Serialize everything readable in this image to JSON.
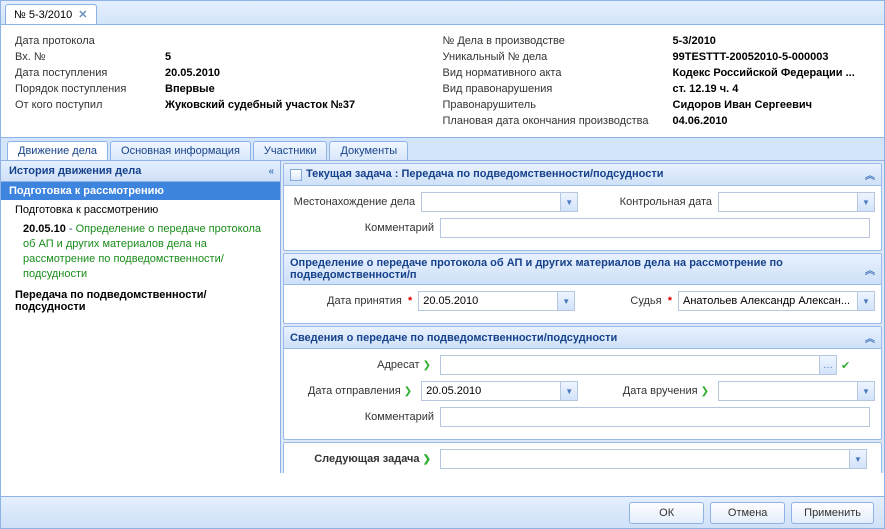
{
  "topTab": {
    "label": "№ 5-3/2010",
    "closeGlyph": "✕"
  },
  "header": {
    "left": [
      {
        "label": "Дата протокола",
        "value": ""
      },
      {
        "label": "Вх. №",
        "value": "5"
      },
      {
        "label": "Дата поступления",
        "value": "20.05.2010"
      },
      {
        "label": "Порядок поступления",
        "value": "Впервые"
      },
      {
        "label": "От кого поступил",
        "value": "Жуковский судебный участок №37"
      }
    ],
    "right": [
      {
        "label": "№ Дела в производстве",
        "value": "5-3/2010"
      },
      {
        "label": "Уникальный № дела",
        "value": "99TESTTT-20052010-5-000003"
      },
      {
        "label": "Вид нормативного акта",
        "value": "Кодекс Российской Федерации ..."
      },
      {
        "label": "Вид правонарушения",
        "value": "ст. 12.19 ч. 4"
      },
      {
        "label": "Правонарушитель",
        "value": "Сидоров Иван Сергеевич"
      },
      {
        "label": "Плановая дата окончания производства",
        "value": "04.06.2010"
      }
    ]
  },
  "tabs": [
    "Движение дела",
    "Основная информация",
    "Участники",
    "Документы"
  ],
  "activeTab": 0,
  "leftPanel": {
    "title": "История движения дела",
    "selectedStage": "Подготовка к рассмотрению",
    "stage1": "Подготовка к рассмотрению",
    "entryDate": "20.05.10",
    "entrySep": " - ",
    "entryText": "Определение о передаче протокола об АП и других материалов дела на рассмотрение по подведомственности/подсудности",
    "stage2": "Передача по подведомственности/подсудности"
  },
  "currentTask": {
    "title": "Текущая задача : Передача по подведомственности/подсудности",
    "locationLabel": "Местонахождение дела",
    "locationValue": "",
    "controlDateLabel": "Контрольная дата",
    "controlDateValue": "",
    "commentLabel": "Комментарий",
    "commentValue": ""
  },
  "decision": {
    "title": "Определение о передаче протокола об АП и других материалов дела на рассмотрение по подведомственности/п",
    "dateLabel": "Дата принятия",
    "dateValue": "20.05.2010",
    "judgeLabel": "Судья",
    "judgeValue": "Анатольев Александр Алексан..."
  },
  "transferInfo": {
    "title": "Сведения о передаче по подведомственности/подсудности",
    "addresseeLabel": "Адресат",
    "addresseeValue": "",
    "sendDateLabel": "Дата отправления",
    "sendDateValue": "20.05.2010",
    "receiveDateLabel": "Дата вручения",
    "receiveDateValue": "",
    "commentLabel": "Комментарий",
    "commentValue": ""
  },
  "nextTask": {
    "label": "Следующая задача",
    "value": ""
  },
  "buttons": {
    "ok": "ОК",
    "cancel": "Отмена",
    "apply": "Применить"
  },
  "glyphs": {
    "collapse": "«",
    "expandUp": "︽",
    "expandDown": "︾",
    "dropdown": "▼",
    "marker": "❯",
    "ellipsis": "…",
    "check": "✔"
  }
}
